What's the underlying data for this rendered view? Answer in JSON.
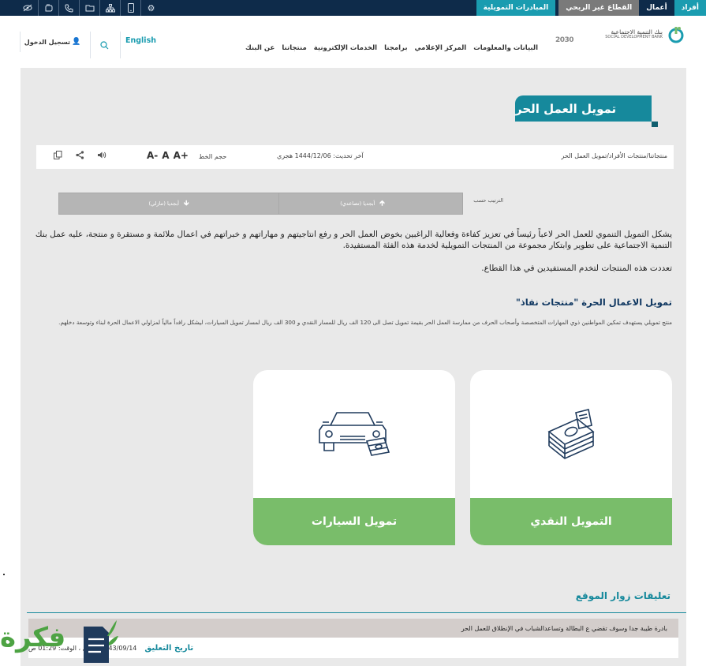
{
  "topbar": {
    "segments": {
      "afrad": "أفراد",
      "aamal": "أعمال",
      "qitaa": "القطاع غير الربحي",
      "mubadarat": "المبادرات التمويلية"
    },
    "icons": [
      "eye-slash-icon",
      "sign-language-icon",
      "phone-icon",
      "folder-icon",
      "sitemap-icon",
      "mobile-icon",
      "gear-icon"
    ],
    "colors": {
      "navy": "#0e2b4a",
      "teal": "#1a9cb0"
    }
  },
  "header": {
    "logo": {
      "name_ar": "بنك التنمية الاجتماعية",
      "name_en": "SOCIAL DEVELOPMENT BANK"
    },
    "vision": "2030",
    "nav": [
      "عن البنك",
      "منتجاتنا",
      "الخدمات الإلكترونية",
      "برامجنا",
      "المركز الإعلامي",
      "البيانات والمعلومات"
    ],
    "language": "English",
    "login": "تسجيل الدخول"
  },
  "page": {
    "title": "تمويل العمل الحر",
    "breadcrumb": "منتجاتنا/منتجات الأفراد/تمويل العمل الحر",
    "updated": "آخر تحديث: 1444/12/06 هجري",
    "font_size_label": "حجم الخط",
    "font_buttons": [
      "A+",
      "A",
      "A-"
    ],
    "sort": {
      "label": "الترتيب حسب",
      "asc": "أبجديا (تصاعدي)",
      "desc": "أبجديا (تنازلي)"
    },
    "intro": "يشكل التمويل التنموي للعمل الحر لاعباً رئيساً في تعزيز كفاءة وفعالية الراغبين بخوض العمل الحر و رفع انتاجيتهم و مهاراتهم و خبراتهم في اعمال ملائمة و مستقرة و منتجة، عليه عمل بنك التنمية الاجتماعية على تطوير وابتكار مجموعة من المنتجات التمويلية لخدمة هذه الفئة المستفيدة.",
    "intro2": "تعددت هذه المنتجات لتخدم المستفيدين في هذا القطاع.",
    "section_title": "تمويل الاعمال الحرة \"منتجات نفاذ\"",
    "section_desc": "منتج تمويلي يستهدف تمكين المواطنين ذوي المهارات المتخصصة وأصحاب الحرف من ممارسة العمل الحر بقيمة تمويل تصل الى 120 الف ريال للمسار النقدي و 300 الف ريال لمسار تمويل السيارات، ليشكل رافداً مالياً لمزاولي الاعمال الحرة لبناء وتوسعة دخلهم.",
    "cards": {
      "cash": "التمويل النقدي",
      "car": "تمويل السيارات"
    },
    "card_accent": "#79bd6a"
  },
  "comments": {
    "title": "تعليقات زوار الموقع",
    "text": "بادرة طيبة جدا وسوف تقضي ع البطالة وتساعدالشباب في الإنطلاق للعمل الحر",
    "date_label": "تاريخ التعليق",
    "date_value": "1443/09/14 هجري ، الوقت: 01:29 ص"
  },
  "watermark": {
    "text": "فكرة"
  }
}
